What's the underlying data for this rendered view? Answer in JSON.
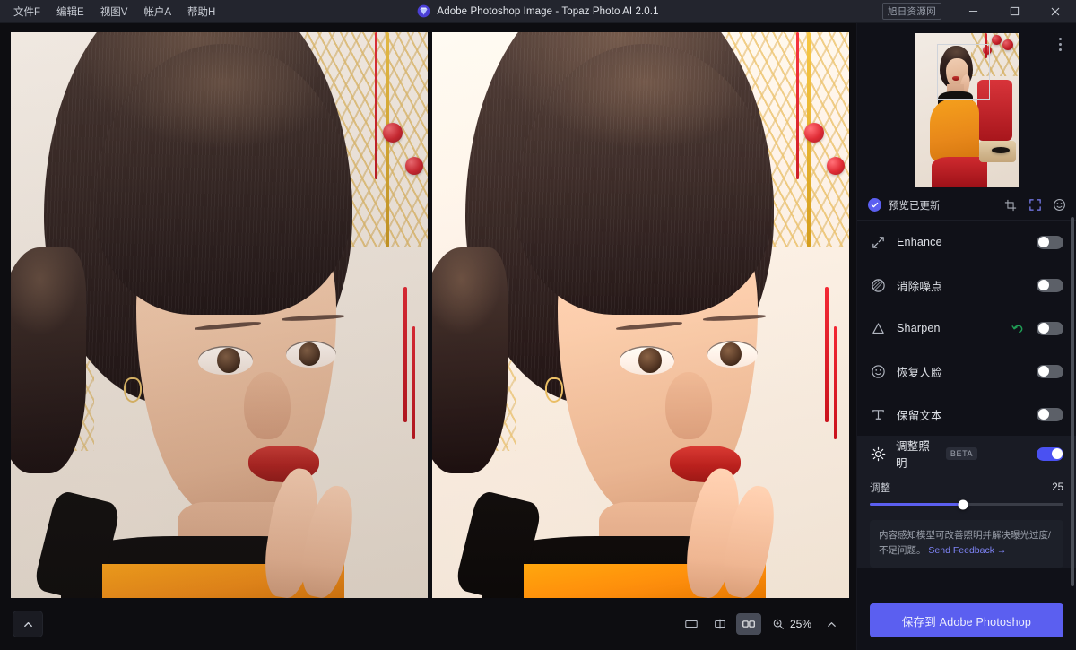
{
  "window": {
    "title": "Adobe Photoshop Image - Topaz Photo AI 2.0.1",
    "logo_icon": "topaz-gem-icon",
    "watermark_badge": "旭日资源网",
    "minimize_icon": "minimize-icon",
    "maximize_icon": "maximize-icon",
    "close_icon": "close-icon"
  },
  "menubar": {
    "items": [
      {
        "label": "文件F",
        "name": "menu-file"
      },
      {
        "label": "编辑E",
        "name": "menu-edit"
      },
      {
        "label": "视图V",
        "name": "menu-view"
      },
      {
        "label": "帐户A",
        "name": "menu-account"
      },
      {
        "label": "帮助H",
        "name": "menu-help"
      }
    ]
  },
  "canvas": {
    "left_pane_label": "original-image",
    "right_pane_label": "enhanced-image",
    "comparison_mode": "side-by-side"
  },
  "bottombar": {
    "collapse_icon": "chevron-up-icon",
    "view_modes": [
      {
        "name": "view-mode-single",
        "icon": "single-view-icon",
        "active": false
      },
      {
        "name": "view-mode-split",
        "icon": "split-view-icon",
        "active": false
      },
      {
        "name": "view-mode-side-by-side",
        "icon": "side-by-side-view-icon",
        "active": true
      }
    ],
    "zoom_icon": "magnifier-icon",
    "zoom_level": "25%",
    "zoom_dropdown_icon": "chevron-up-icon"
  },
  "panel": {
    "kebab_icon": "more-options-icon",
    "thumbnail": {
      "name": "preview-thumbnail",
      "face_box": "face-detection-box"
    },
    "status": {
      "check_icon": "check-circle-icon",
      "text": "预览已更新",
      "tools": [
        {
          "name": "crop-icon",
          "active": false
        },
        {
          "name": "fit-to-screen-icon",
          "active": true
        },
        {
          "name": "face-detect-icon",
          "active": false
        }
      ]
    },
    "filters": [
      {
        "label": "Enhance",
        "icon": "enhance-arrows-icon",
        "enabled": false,
        "has_undo": false
      },
      {
        "label": "消除噪点",
        "icon": "denoise-circle-icon",
        "enabled": false,
        "has_undo": false
      },
      {
        "label": "Sharpen",
        "icon": "sharpen-triangle-icon",
        "enabled": false,
        "has_undo": true
      },
      {
        "label": "恢复人脸",
        "icon": "face-recovery-icon",
        "enabled": false,
        "has_undo": false
      },
      {
        "label": "保留文本",
        "icon": "preserve-text-icon",
        "enabled": false,
        "has_undo": false
      }
    ],
    "lighting": {
      "icon": "sun-brightness-icon",
      "label": "调整照明",
      "badge": "BETA",
      "enabled": true,
      "slider_label": "调整",
      "slider_value": "25",
      "slider_percent": 48,
      "description": "内容感知模型可改善照明并解决曝光过度/不足问题。",
      "feedback_link": "Send Feedback →"
    },
    "save_button": "保存到 Adobe Photoshop"
  },
  "colors": {
    "accent": "#5b5ff0",
    "titlebar": "#23252e",
    "panel_bg": "#101118",
    "undo_green": "#1f9d55"
  }
}
